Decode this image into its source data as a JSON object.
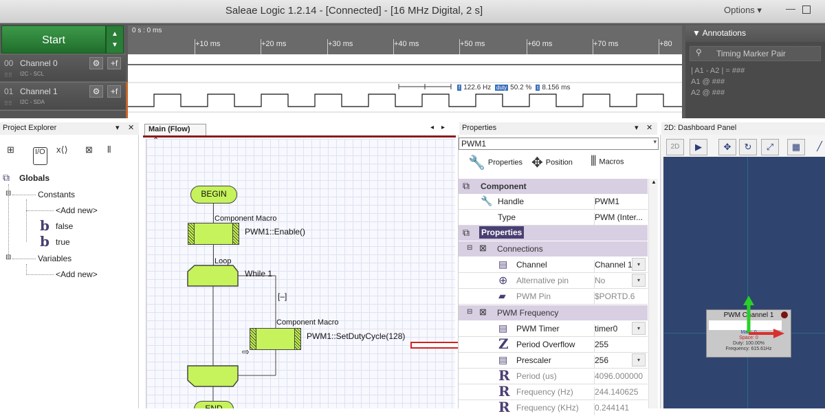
{
  "saleae": {
    "title": "Saleae Logic 1.2.14 - [Connected] - [16 MHz Digital, 2 s]",
    "options_label": "Options",
    "start_label": "Start",
    "time_origin": "0 s : 0 ms",
    "ticks": [
      "+10 ms",
      "+20 ms",
      "+30 ms",
      "+40 ms",
      "+50 ms",
      "+60 ms",
      "+70 ms",
      "+80"
    ],
    "channels": [
      {
        "num": "00",
        "name": "Channel 0",
        "protocol": "I2C - SCL"
      },
      {
        "num": "01",
        "name": "Channel 1",
        "protocol": "I2C - SDA"
      }
    ],
    "measurement": {
      "freq_badge": "f",
      "freq": "122.6 Hz",
      "duty_badge": "duty",
      "duty": "50.2 %",
      "period_badge": "t",
      "period": "8.156 ms"
    },
    "annotations": {
      "header": "Annotations",
      "selector": "Timing Marker Pair",
      "rows": [
        "| A1 - A2 | = ###",
        "A1  @  ###",
        "A2  @  ###"
      ]
    }
  },
  "project_explorer": {
    "title": "Project Explorer",
    "globals": "Globals",
    "constants": "Constants",
    "add_new_1": "<Add new>",
    "const_false": "false",
    "const_true": "true",
    "variables": "Variables",
    "add_new_2": "<Add new>"
  },
  "flow": {
    "tab_label": "Main (Flow)",
    "begin": "BEGIN",
    "macro1_title": "Component Macro",
    "macro1_call": "PWM1::Enable()",
    "loop_label": "Loop",
    "while_label": "While 1",
    "collapse": "[–]",
    "macro2_title": "Component Macro",
    "macro2_call": "PWM1::SetDutyCycle(128)",
    "end": "END"
  },
  "properties": {
    "title": "Properties",
    "combo_value": "PWM1",
    "tabs": [
      "Properties",
      "Position",
      "Macros"
    ],
    "component_section": "Component",
    "handle_key": "Handle",
    "handle_val": "PWM1",
    "type_key": "Type",
    "type_val": "PWM (Inter...",
    "properties_section": "Properties",
    "connections_section": "Connections",
    "channel_key": "Channel",
    "channel_val": "Channel 1",
    "altpin_key": "Alternative pin",
    "altpin_val": "No",
    "pwmpin_key": "PWM Pin",
    "pwmpin_val": "$PORTD.6",
    "freq_section": "PWM Frequency",
    "timer_key": "PWM Timer",
    "timer_val": "timer0",
    "overflow_key": "Period Overflow",
    "overflow_val": "255",
    "prescaler_key": "Prescaler",
    "prescaler_val": "256",
    "period_key": "Period (us)",
    "period_val": "4096.000000",
    "frequency_key": "Frequency (Hz)",
    "frequency_val": "244.140625",
    "frequency_khz_key": "Frequency (KHz)",
    "frequency_khz_val": "0.244141"
  },
  "dashboard": {
    "title": "2D: Dashboard Panel",
    "component_label": "PWM Channel 1",
    "mark": "Mark: 0",
    "space": "Space: 0",
    "duty": "Duty: 100.00%",
    "frequency": "Frequency: 615.61Hz"
  }
}
